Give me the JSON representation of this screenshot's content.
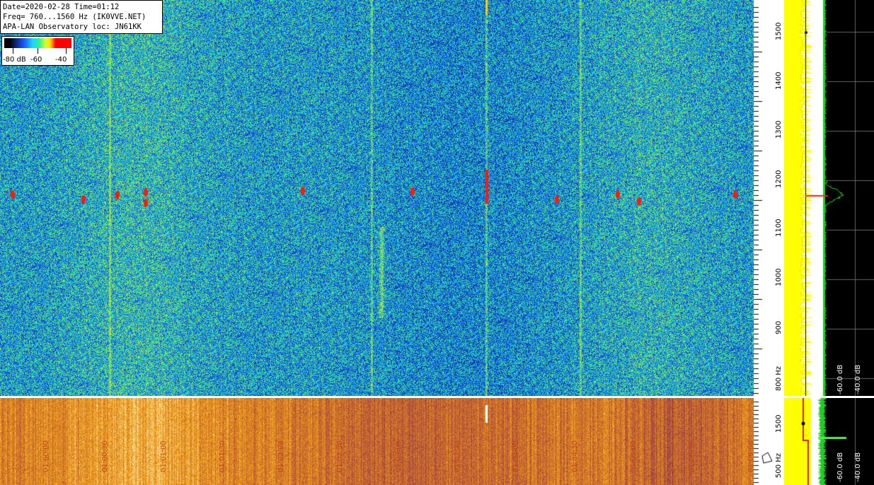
{
  "info": {
    "line1": "Date=2020-02-28 Time=01:12",
    "line2": "Freq= 760...1560 Hz (IK0VVE.NET)",
    "line3": "APA-LAN Observatory loc: JN61KK"
  },
  "colorbar": {
    "label_left": "-80 dB",
    "label_mid": "-60",
    "label_right": "-40"
  },
  "top_axis": {
    "ticks": [
      "1500",
      "1400",
      "1300",
      "1200",
      "1100",
      "1000",
      "900",
      "800 Hz"
    ]
  },
  "top_spectrum": {
    "db_labels": [
      "-60.0 dB",
      "-40.0 dB"
    ]
  },
  "bottom_axis": {
    "ticks": [
      "1500",
      "500 Hz"
    ]
  },
  "bottom_spectrum": {
    "db_labels": [
      "-60.0 dB",
      "-40.0 dB"
    ]
  },
  "time_labels": [
    "01:00:00",
    "01:00:30",
    "01:01:00",
    "01:01:30",
    "01:02:00",
    "01:02:30",
    "01:03:00",
    "01:03:30",
    "01:04:00",
    "01:04:30",
    "01:05:00",
    "01:05:30",
    "01:06:00"
  ],
  "colors": {
    "spectrum_fill": "#ffff00",
    "spectrum_green": "#22cc22",
    "marker_red": "#ff2020",
    "grid_gray": "#888888"
  }
}
